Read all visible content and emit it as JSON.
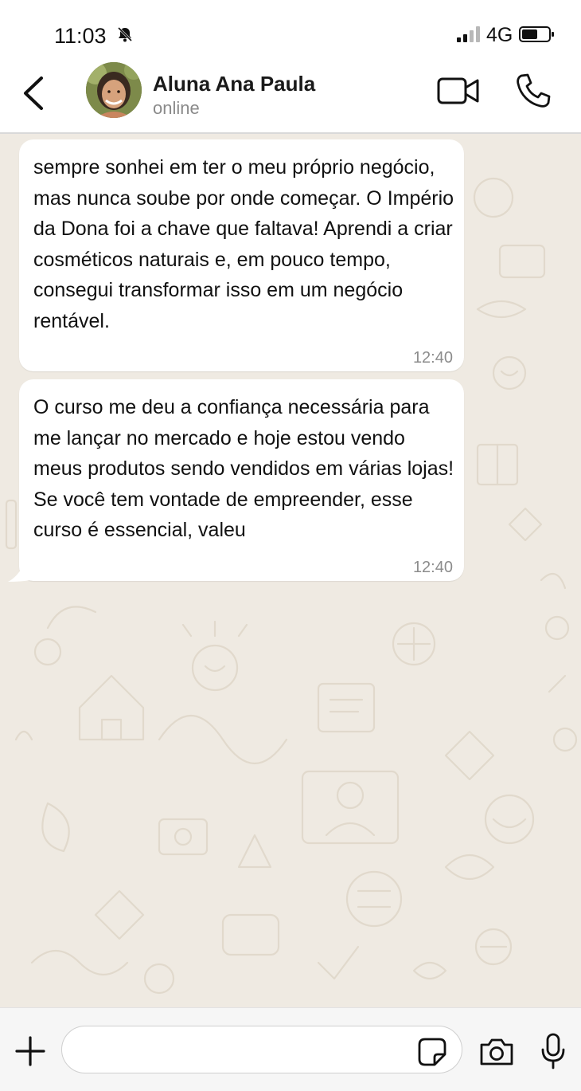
{
  "status_bar": {
    "time": "11:03",
    "network": "4G",
    "icons": [
      "bell-muted-icon",
      "signal-icon",
      "battery-icon"
    ]
  },
  "header": {
    "contact_name": "Aluna Ana Paula",
    "contact_status": "online",
    "icons": [
      "back-icon",
      "avatar",
      "video-icon",
      "phone-icon"
    ]
  },
  "messages": [
    {
      "text": "sempre sonhei em ter o meu próprio negócio, mas nunca soube por onde começar. O Império da Dona foi a chave que faltava! Aprendi a criar cosméticos naturais e, em pouco tempo, consegui transformar isso em um negócio rentável.",
      "time": "12:40"
    },
    {
      "text": "O curso me deu a confiança necessária para me lançar no mercado e hoje estou vendo meus produtos sendo vendidos em várias lojas! Se você tem vontade de empreender, esse curso é essencial, valeu",
      "time": "12:40"
    }
  ],
  "input_bar": {
    "value": "",
    "placeholder": "",
    "icons": [
      "plus-icon",
      "sticker-icon",
      "camera-icon",
      "mic-icon"
    ]
  },
  "colors": {
    "chat_background": "#efeae2",
    "bubble": "#ffffff",
    "header_background": "#ffffff",
    "input_bar_background": "#f6f6f6"
  }
}
